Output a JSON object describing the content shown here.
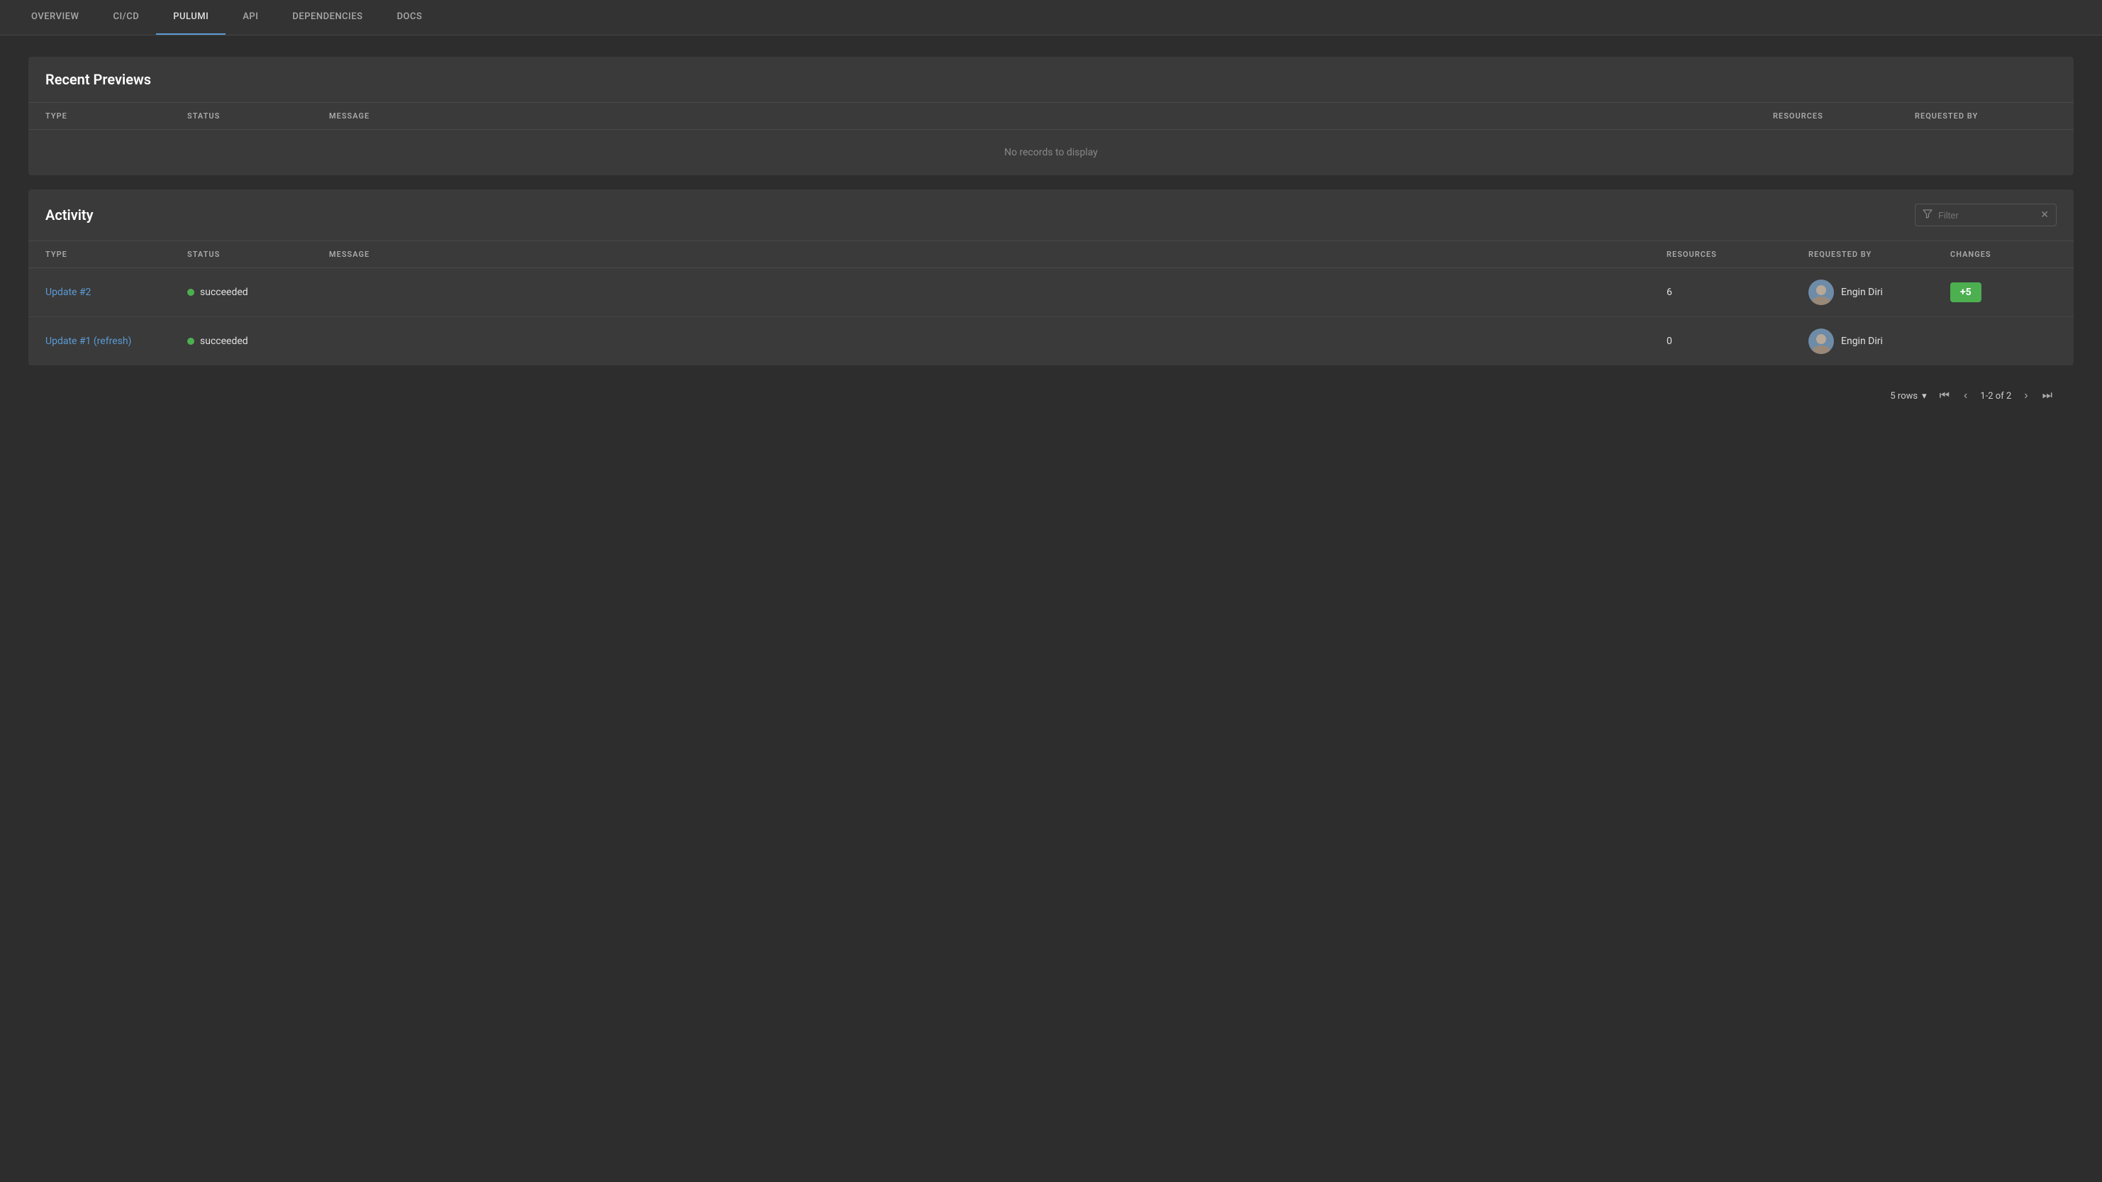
{
  "nav": {
    "tabs": [
      {
        "id": "overview",
        "label": "OVERVIEW",
        "active": false
      },
      {
        "id": "cicd",
        "label": "CI/CD",
        "active": false
      },
      {
        "id": "pulumi",
        "label": "PULUMI",
        "active": true
      },
      {
        "id": "api",
        "label": "API",
        "active": false
      },
      {
        "id": "dependencies",
        "label": "DEPENDENCIES",
        "active": false
      },
      {
        "id": "docs",
        "label": "DOCS",
        "active": false
      }
    ]
  },
  "recent_previews": {
    "title": "Recent Previews",
    "columns": [
      "TYPE",
      "STATUS",
      "MESSAGE",
      "RESOURCES",
      "REQUESTED BY"
    ],
    "empty_message": "No records to display",
    "rows": []
  },
  "activity": {
    "title": "Activity",
    "filter_placeholder": "Filter",
    "columns": [
      "TYPE",
      "STATUS",
      "MESSAGE",
      "RESOURCES",
      "REQUESTED BY",
      "CHANGES"
    ],
    "rows": [
      {
        "id": 1,
        "type": "Update #2",
        "status": "succeeded",
        "message": "",
        "resources": "6",
        "requested_by": "Engin Diri",
        "changes": "+5",
        "has_changes": true
      },
      {
        "id": 2,
        "type": "Update #1 (refresh)",
        "status": "succeeded",
        "message": "",
        "resources": "0",
        "requested_by": "Engin Diri",
        "changes": "",
        "has_changes": false
      }
    ]
  },
  "pagination": {
    "rows_label": "5 rows",
    "page_info": "1-2 of 2"
  }
}
